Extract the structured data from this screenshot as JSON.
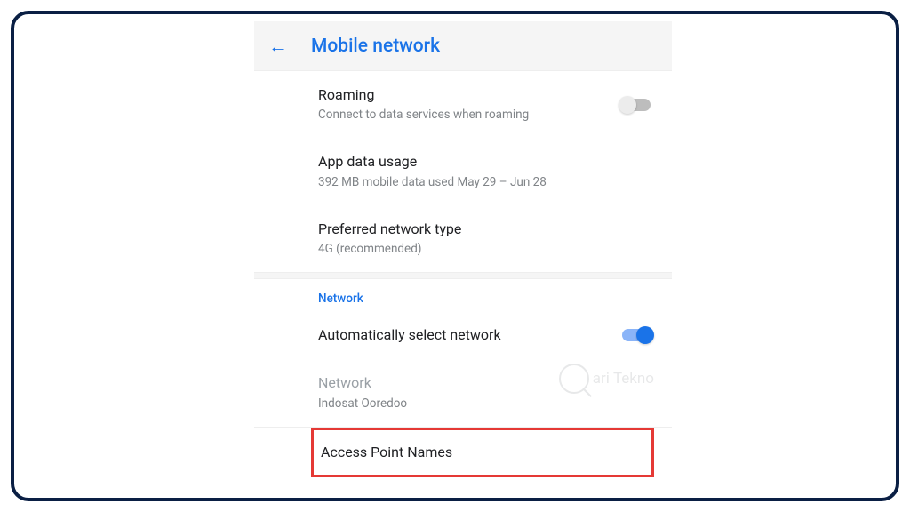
{
  "header": {
    "title": "Mobile network"
  },
  "items": {
    "roaming": {
      "title": "Roaming",
      "subtitle": "Connect to data services when roaming"
    },
    "appDataUsage": {
      "title": "App data usage",
      "subtitle": "392 MB mobile data used May 29 – Jun 28"
    },
    "preferredNetwork": {
      "title": "Preferred network type",
      "subtitle": "4G (recommended)"
    },
    "sectionNetwork": "Network",
    "autoSelect": {
      "title": "Automatically select network"
    },
    "network": {
      "title": "Network",
      "subtitle": "Indosat Ooredoo"
    },
    "apn": {
      "title": "Access Point Names"
    }
  },
  "watermark": {
    "part1": "ari",
    "part2": "Tekno"
  }
}
